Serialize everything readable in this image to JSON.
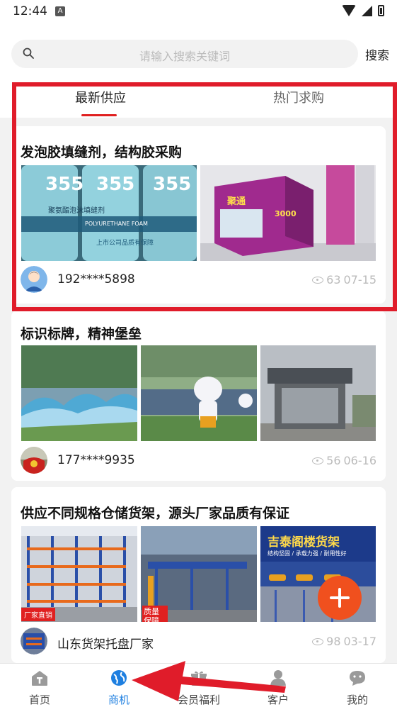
{
  "status_bar": {
    "time": "12:44",
    "notif_letter": "A"
  },
  "search": {
    "placeholder": "请输入搜索关键词",
    "button_label": "搜索"
  },
  "tabs": [
    {
      "label": "最新供应",
      "active": true
    },
    {
      "label": "热门求购",
      "active": false
    }
  ],
  "posts": [
    {
      "title": "发泡胶填缝剂，结构胶采购",
      "user": "192****5898",
      "views": "63",
      "date": "07-15"
    },
    {
      "title": "标识标牌，精神堡垒",
      "user": "177****9935",
      "views": "56",
      "date": "06-16"
    },
    {
      "title": "供应不同规格仓储货架，源头厂家品质有保证",
      "user": "山东货架托盘厂家",
      "views": "98",
      "date": "03-17"
    }
  ],
  "photo_texts": {
    "can_number": "355",
    "can_band": "聚氨酯泡沫填缝剂",
    "can_en": "POLYURETHANE FOAM",
    "can_note": "上市公司品质有保障",
    "box_number": "3000",
    "box_brand": "聚通",
    "factory_tag": "厂家直销",
    "quality_tag": "质量保障",
    "shelf_banner": "吉泰阁楼货架",
    "shelf_sub": "结构坚固 / 承载力强 / 耐用性好"
  },
  "bottom_nav": [
    {
      "label": "首页",
      "active": false
    },
    {
      "label": "商机",
      "active": true
    },
    {
      "label": "会员福利",
      "active": false
    },
    {
      "label": "客户",
      "active": false
    },
    {
      "label": "我的",
      "active": false
    }
  ],
  "colors": {
    "accent_red": "#e02020",
    "nav_active": "#1e7fe0",
    "fab": "#f0501e",
    "highlight_box": "#e01c2a"
  }
}
